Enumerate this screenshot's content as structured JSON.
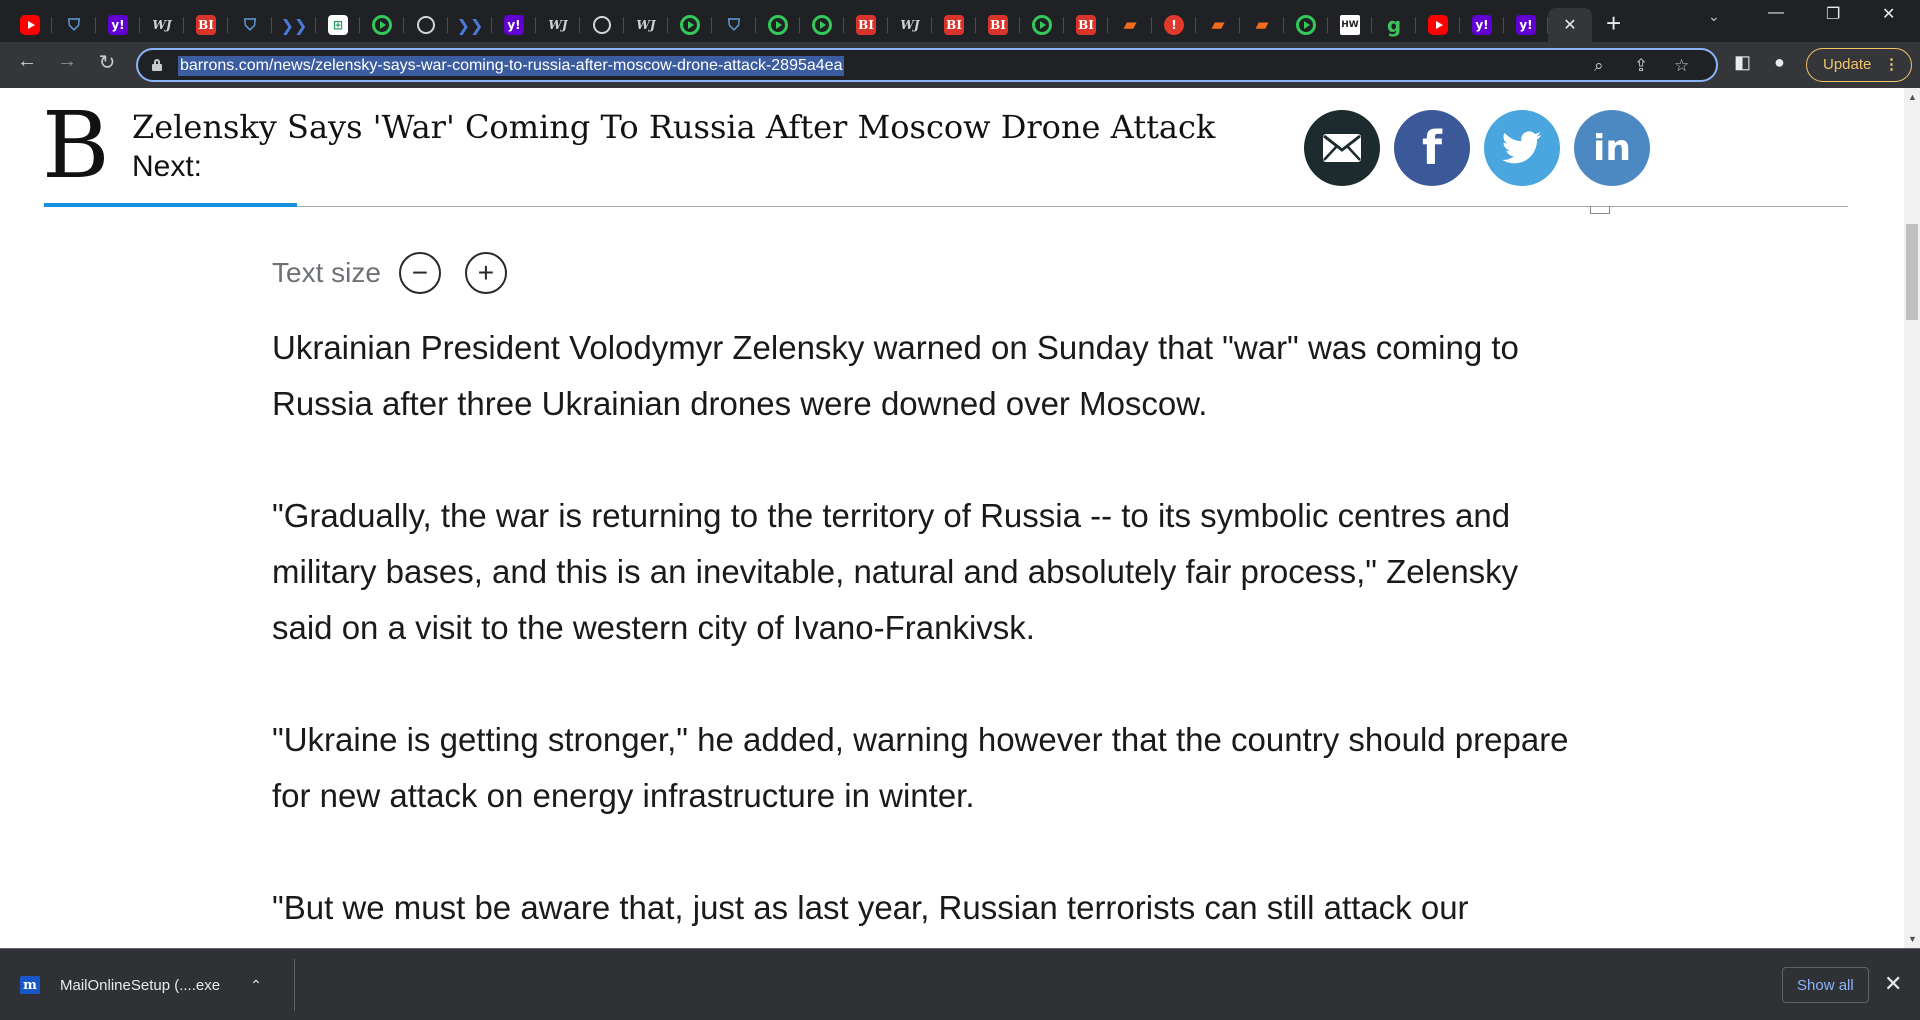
{
  "tabstrip": {
    "favicons": [
      {
        "icon": "youtube-icon",
        "cls": "yt",
        "glyph": ""
      },
      {
        "icon": "shield-icon",
        "cls": "shield",
        "glyph": "⛉"
      },
      {
        "icon": "yahoo-icon",
        "cls": "yahoo",
        "glyph": "y!"
      },
      {
        "icon": "wsj-icon",
        "cls": "wsj",
        "glyph": "WJ"
      },
      {
        "icon": "business-insider-icon",
        "cls": "bi",
        "glyph": "BI"
      },
      {
        "icon": "shield-icon",
        "cls": "shield",
        "glyph": "⛉"
      },
      {
        "icon": "arrow-icon",
        "cls": "arrow",
        "glyph": "❯❯"
      },
      {
        "icon": "spreadsheet-icon",
        "cls": "grid",
        "glyph": "⊞"
      },
      {
        "icon": "play-icon",
        "cls": "play",
        "glyph": ""
      },
      {
        "icon": "globe-icon",
        "cls": "globe",
        "glyph": ""
      },
      {
        "icon": "arrow-icon",
        "cls": "arrow",
        "glyph": "❯❯"
      },
      {
        "icon": "yahoo-icon",
        "cls": "yahoo",
        "glyph": "y!"
      },
      {
        "icon": "wsj-icon",
        "cls": "wsj",
        "glyph": "WJ"
      },
      {
        "icon": "globe-icon",
        "cls": "globe",
        "glyph": ""
      },
      {
        "icon": "wsj-icon",
        "cls": "wsj",
        "glyph": "WJ"
      },
      {
        "icon": "play-icon",
        "cls": "play",
        "glyph": ""
      },
      {
        "icon": "shield-icon",
        "cls": "shield",
        "glyph": "⛉"
      },
      {
        "icon": "play-icon",
        "cls": "play",
        "glyph": ""
      },
      {
        "icon": "play-icon",
        "cls": "play",
        "glyph": ""
      },
      {
        "icon": "business-insider-icon",
        "cls": "bi",
        "glyph": "BI"
      },
      {
        "icon": "wsj-icon",
        "cls": "wsj",
        "glyph": "WJ"
      },
      {
        "icon": "business-insider-icon",
        "cls": "bi",
        "glyph": "BI"
      },
      {
        "icon": "business-insider-icon",
        "cls": "bi",
        "glyph": "BI"
      },
      {
        "icon": "play-icon",
        "cls": "play",
        "glyph": ""
      },
      {
        "icon": "business-insider-icon",
        "cls": "bi",
        "glyph": "BI"
      },
      {
        "icon": "bookmark-icon",
        "cls": "bm",
        "glyph": "▰"
      },
      {
        "icon": "red-circle-icon",
        "cls": "red",
        "glyph": "!"
      },
      {
        "icon": "bookmark-icon",
        "cls": "bm",
        "glyph": "▰"
      },
      {
        "icon": "bookmark-icon",
        "cls": "bm",
        "glyph": "▰"
      },
      {
        "icon": "play-icon",
        "cls": "play",
        "glyph": ""
      },
      {
        "icon": "hw-icon",
        "cls": "hw",
        "glyph": "HW"
      },
      {
        "icon": "g-icon",
        "cls": "g",
        "glyph": "g"
      },
      {
        "icon": "youtube-icon",
        "cls": "yt",
        "glyph": ""
      },
      {
        "icon": "yahoo-icon",
        "cls": "yahoo",
        "glyph": "y!"
      },
      {
        "icon": "yahoo-icon",
        "cls": "yahoo",
        "glyph": "y!"
      }
    ],
    "active_close": "✕",
    "new_tab": "+",
    "tab_search": "⌄",
    "minimize": "—",
    "restore": "❐",
    "close": "✕"
  },
  "toolbar": {
    "back": "←",
    "forward": "→",
    "reload": "↻",
    "url": "barrons.com/news/zelensky-says-war-coming-to-russia-after-moscow-drone-attack-2895a4ea",
    "zoom_icon": "⌕",
    "share_icon": "⇪",
    "bookmark_icon": "☆",
    "sidepanel_icon": "◧",
    "profile_icon": "●",
    "update_label": "Update",
    "menu_icon": "⋮"
  },
  "article_header": {
    "logo": "B",
    "headline": "Zelensky Says 'War' Coming To Russia After Moscow Drone Attack",
    "next_label": "Next:",
    "progress": 0.14
  },
  "share_buttons": {
    "email": "✉",
    "facebook": "f",
    "twitter": "🐦",
    "linkedin": "in"
  },
  "text_size": {
    "label": "Text size",
    "minus": "−",
    "plus": "+"
  },
  "article": {
    "paragraphs": [
      "Ukrainian President Volodymyr Zelensky warned on Sunday that \"war\" was coming to Russia after three Ukrainian drones were downed over Moscow.",
      "\"Gradually, the war is returning to the territory of Russia -- to its symbolic centres and military bases, and this is an inevitable, natural and absolutely fair process,\" Zelensky said on a visit to the western city of Ivano-Frankivsk.",
      "\"Ukraine is getting stronger,\" he added, warning however that the country should prepare for new attack on energy infrastructure in winter.",
      "\"But we must be aware that, just as last year, Russian terrorists can still attack our"
    ]
  },
  "download_bar": {
    "icon": "m",
    "filename": "MailOnlineSetup (....exe",
    "chevron": "⌃",
    "show_all": "Show all",
    "close": "✕"
  }
}
